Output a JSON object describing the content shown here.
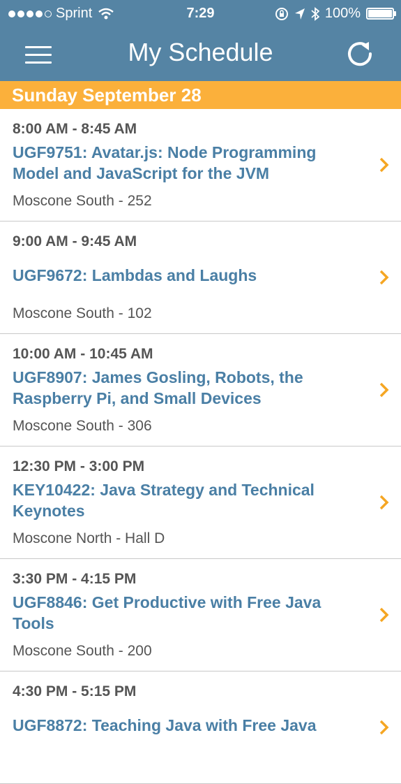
{
  "status_bar": {
    "carrier": "Sprint",
    "time": "7:29",
    "battery": "100%",
    "battery_level": 1.0
  },
  "nav": {
    "title": "My Schedule",
    "menu_icon": "hamburger-menu-icon",
    "refresh_icon": "refresh-icon"
  },
  "section": {
    "date": "Sunday September 28"
  },
  "sessions": [
    {
      "time": "8:00 AM - 8:45 AM",
      "title": "UGF9751: Avatar.js: Node Programming Model and JavaScript for the JVM",
      "room": "Moscone South - 252"
    },
    {
      "time": "9:00 AM - 9:45 AM",
      "title": "UGF9672: Lambdas and Laughs",
      "room": "Moscone South - 102"
    },
    {
      "time": "10:00 AM - 10:45 AM",
      "title": "UGF8907: James Gosling, Robots, the Raspberry Pi, and Small Devices",
      "room": "Moscone South - 306"
    },
    {
      "time": "12:30 PM - 3:00 PM",
      "title": "KEY10422: Java Strategy and Technical Keynotes",
      "room": "Moscone North - Hall D"
    },
    {
      "time": "3:30 PM - 4:15 PM",
      "title": "UGF8846: Get Productive with Free Java Tools",
      "room": "Moscone South - 200"
    },
    {
      "time": "4:30 PM - 5:15 PM",
      "title": "UGF8872: Teaching Java with Free Java",
      "room": ""
    }
  ],
  "colors": {
    "nav_bg": "#5584a4",
    "section_bg": "#fbb03b",
    "title_link": "#4a7fa5",
    "chevron": "#f5a623"
  }
}
